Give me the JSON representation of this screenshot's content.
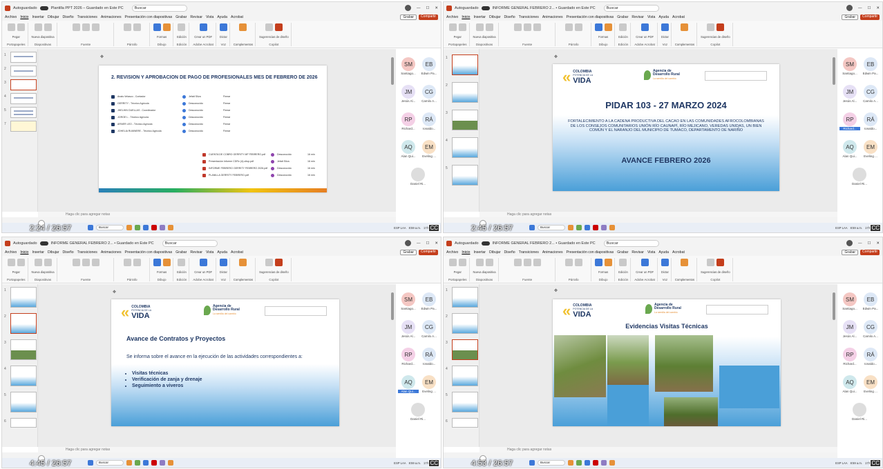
{
  "panels": [
    {
      "timecode": "2:24 / 26:57",
      "window_title": "Plantilla PPT 2026 – Guardado en Este PC",
      "thumb_count": 7,
      "selected_thumb": 4,
      "slide_title": "2. REVISION Y APROBACION DE PAGO DE PROFESIONALES MES DE FEBRERO DE 2026"
    },
    {
      "timecode": "2:45 / 26:57",
      "window_title": "INFORME GENERAL FEBRERO 2... • Guardado en Este PC",
      "thumb_count": 5,
      "selected_thumb": 1,
      "slide_title": "PIDAR 103 - 27 MARZO 2024"
    },
    {
      "timecode": "4:45 / 26:57",
      "window_title": "INFORME GENERAL FEBRERO 2... • Guardado en Este PC",
      "thumb_count": 6,
      "selected_thumb": 2,
      "slide_title": "Avance de Contratos y Proyectos"
    },
    {
      "timecode": "4:53 / 26:57",
      "window_title": "INFORME GENERAL FEBRERO 2... • Guardado en Este PC",
      "thumb_count": 6,
      "selected_thumb": 3,
      "slide_title": "Evidencias Visitas Técnicas"
    }
  ],
  "app": {
    "autosave": "Autoguardado",
    "search": "Buscar",
    "grabar": "Grabar",
    "compartir": "Compartir",
    "menu": [
      "Archivo",
      "Inicio",
      "Insertar",
      "Dibujar",
      "Diseño",
      "Transiciones",
      "Animaciones",
      "Presentación con diapositivas",
      "Grabar",
      "Revisar",
      "Vista",
      "Ayuda",
      "Acrobat"
    ],
    "notes": "Haga clic para agregar notas",
    "taskbar_search": "Buscar",
    "time": "8:59 a.m.",
    "date": "17/03/2026",
    "lang": "ESP LAA"
  },
  "ribbon_groups": [
    {
      "label": "Portapapeles",
      "item": "Pegar"
    },
    {
      "label": "Diapositivas",
      "item": "Nueva diapositiva"
    },
    {
      "label": "Fuente",
      "item": ""
    },
    {
      "label": "Párrafo",
      "item": ""
    },
    {
      "label": "Dibujo",
      "item": "Formas"
    },
    {
      "label": "Edición",
      "item": "Edición"
    },
    {
      "label": "Adobe Acrobat",
      "item": "Crear un PDF"
    },
    {
      "label": "Voz",
      "item": "Dictar"
    },
    {
      "label": "Complementos",
      "item": "Complementos"
    },
    {
      "label": "Copilot",
      "item": "Sugerencias de diseño"
    }
  ],
  "participants": [
    {
      "initials": "SM",
      "name": "Santiago..."
    },
    {
      "initials": "EB",
      "name": "Edwin Pa..."
    },
    {
      "initials": "JM",
      "name": "Jesús Al..."
    },
    {
      "initials": "CG",
      "name": "Camilo A..."
    },
    {
      "initials": "RP",
      "name": "Richard..."
    },
    {
      "initials": "RÁ",
      "name": "ronaldo..."
    },
    {
      "initials": "AQ",
      "name": "Alan Qui..."
    },
    {
      "initials": "EM",
      "name": "Eveling ..."
    },
    {
      "initials": "",
      "name": "Daniel Ri..."
    }
  ],
  "slide1": {
    "rows": [
      {
        "name": "Anais Velasco - Contador",
        "person": "Jefatt Silva",
        "status": "Firmar"
      },
      {
        "name": "GERRITY - Técnico Agrícola",
        "person": "Desconocido",
        "status": "Firmar"
      },
      {
        "name": "JHELHIN DUELLAS - Coordinador",
        "person": "Desconocido",
        "status": "Firmar"
      },
      {
        "name": "JORGE L - Técnico Agrícola",
        "person": "Desconocido",
        "status": "Firmar"
      },
      {
        "name": "ARNER LEO - Técnico Agrícola",
        "person": "Desconocido",
        "status": "Firmar"
      },
      {
        "name": "JOHELIA RUMNERE - Técnico Agrícola",
        "person": "Desconocido",
        "status": "Firmar"
      }
    ],
    "files": [
      {
        "name": "CUENTA DE COBRO GERRITY MP FEBRERO.pdf",
        "person": "Desconocido",
        "time": "16 min"
      },
      {
        "name": "Presentación Informe CDRx (4)-ultop.pdf",
        "person": "Jefatt Silva",
        "time": "16 min"
      },
      {
        "name": "INFORME FEBRERO GERRITY FEBRERO 2026.pdf",
        "person": "Desconocido",
        "time": "16 min"
      },
      {
        "name": "PLANILLA GERRITY FEBRERO.pdf",
        "person": "Desconocido",
        "time": "16 min"
      }
    ]
  },
  "brand": {
    "colombia": "COLOMBIA",
    "potencia": "POTENCIA DE LA",
    "vida": "VIDA",
    "agencia1": "Agencia de",
    "agencia2": "Desarrollo Rural",
    "semilla": "La semilla del cambio"
  },
  "slide2": {
    "subtitle": "FORTALECIMIENTO A LA CADENA PRODUCTIVA DEL CACAO EN LAS COMUNIDADES AFROCOLOMBIANAS DE LOS CONSEJOS COMUNITARIOS UNIÓN RÍO CAUNAPÍ, RÍO MEJICANO, VEREDAS UNIDAS, UN BIEN COMÚN Y EL NARANJO DEL MUNICIPIO DE TUMACO, DEPARTAMENTO DE NARIÑO",
    "avance": "AVANCE FEBRERO 2026"
  },
  "slide3": {
    "intro": "Se informa sobre el avance en la ejecución de las actividades correspondientes a:",
    "bullets": [
      "Visitas técnicas",
      "Verificación de zanja y drenaje",
      "Seguimiento a viveros"
    ]
  },
  "colors": {
    "accent": "#c43e1c",
    "navy": "#1f3864",
    "sky": "#4a9fd8"
  }
}
